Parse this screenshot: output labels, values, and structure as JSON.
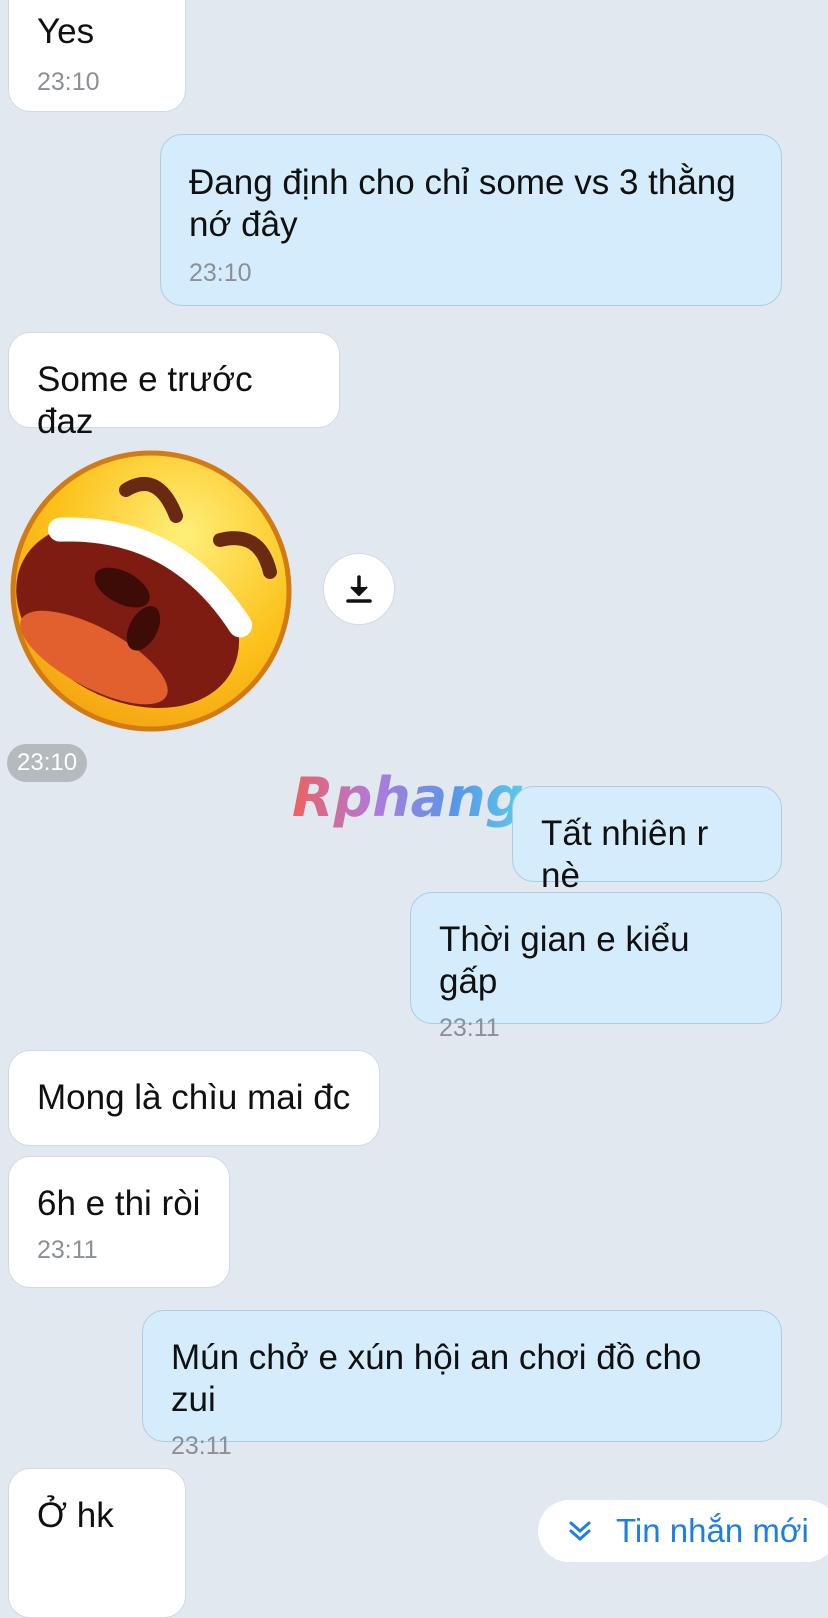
{
  "messages": [
    {
      "direction": "in",
      "text": "Yes",
      "time": "23:10"
    },
    {
      "direction": "out",
      "text": "Đang định cho chỉ some vs 3 thằng nớ đây",
      "time": "23:10"
    },
    {
      "direction": "in",
      "text": "Some e trước đaz",
      "time": ""
    },
    {
      "direction": "in",
      "type": "sticker",
      "sticker": "laughing-face-sticker",
      "time": "23:10"
    },
    {
      "direction": "out",
      "text": "Tất nhiên r nè",
      "time": ""
    },
    {
      "direction": "out",
      "text": "Thời gian e kiểu gấp",
      "time": "23:11"
    },
    {
      "direction": "in",
      "text": "Mong là chìu mai đc",
      "time": ""
    },
    {
      "direction": "in",
      "text": "6h e thi ròi",
      "time": "23:11"
    },
    {
      "direction": "out",
      "text": "Mún chở e xún hội an chơi đồ cho zui",
      "time": "23:11"
    },
    {
      "direction": "in",
      "text": "Ở hk",
      "time": ""
    }
  ],
  "sticker_time": "23:10",
  "download_icon": "download-icon",
  "watermark": {
    "text": "Rphang"
  },
  "new_message_button": {
    "label": "Tin nhắn mới",
    "icon": "chevron-double-down-icon"
  },
  "colors": {
    "background": "#e2e8f0",
    "incoming_bubble": "#ffffff",
    "outgoing_bubble": "#d4ecfb",
    "accent": "#1d7fe3",
    "timestamp": "#8b9096"
  }
}
